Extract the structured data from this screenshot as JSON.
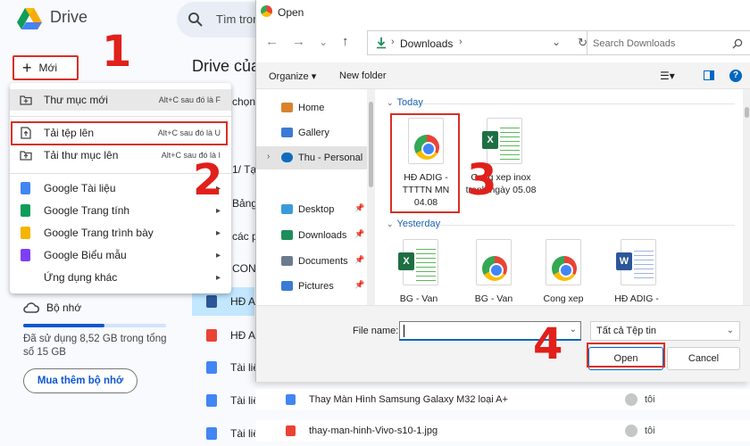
{
  "drive": {
    "title": "Drive",
    "search_text": "Tìm tron",
    "new_button": "Mới",
    "heading": "Drive của",
    "partial_texts": [
      "chọn",
      "1/ Tại",
      "Bảng",
      "các p",
      "CONT"
    ],
    "bg_rows": [
      "HĐ A",
      "HĐ A",
      "Tài liệ",
      "Tài liệ",
      "Tài liệ"
    ],
    "storage": {
      "label": "Bộ nhớ",
      "used_text": "Đã sử dụng 8,52 GB trong tổng số 15 GB",
      "used_fraction": 0.568,
      "buy_button": "Mua thêm bộ nhớ"
    }
  },
  "new_menu": {
    "items": [
      {
        "label": "Thư mục mới",
        "shortcut": "Alt+C sau đó là F",
        "icon": "new-folder-icon",
        "color": "#444746"
      },
      {
        "label": "Tải tệp lên",
        "shortcut": "Alt+C sau đó là U",
        "icon": "upload-file-icon",
        "color": "#444746"
      },
      {
        "label": "Tải thư mục lên",
        "shortcut": "Alt+C sau đó là I",
        "icon": "upload-folder-icon",
        "color": "#444746"
      },
      {
        "label": "Google Tài liệu",
        "shortcut": "",
        "icon": "google-docs-icon",
        "color": "#4285f4"
      },
      {
        "label": "Google Trang tính",
        "shortcut": "",
        "icon": "google-sheets-icon",
        "color": "#0f9d58"
      },
      {
        "label": "Google Trang trình bày",
        "shortcut": "",
        "icon": "google-slides-icon",
        "color": "#f4b400"
      },
      {
        "label": "Google Biểu mẫu",
        "shortcut": "",
        "icon": "google-forms-icon",
        "color": "#7e3ff2"
      },
      {
        "label": "Ứng dụng khác",
        "shortcut": "",
        "icon": "more-apps-icon",
        "color": "#ffffff"
      }
    ]
  },
  "annotations": {
    "step1": "1",
    "step2": "2",
    "step3": "3",
    "step4": "4",
    "color": "#e0201b"
  },
  "dialog": {
    "title": "Open",
    "address": "Downloads",
    "search_placeholder": "Search Downloads",
    "toolbar": {
      "organize": "Organize ▾",
      "new_folder": "New folder"
    },
    "nav_items": [
      {
        "label": "Home",
        "icon": "home-icon",
        "color": "#d9822b"
      },
      {
        "label": "Gallery",
        "icon": "gallery-icon",
        "color": "#3a7bd5"
      },
      {
        "label": "Thu - Personal",
        "icon": "onedrive-icon",
        "color": "#0f6cbd"
      },
      {
        "label": "Desktop",
        "icon": "desktop-icon",
        "color": "#3a9bdc"
      },
      {
        "label": "Downloads",
        "icon": "downloads-icon",
        "color": "#1e8e5a"
      },
      {
        "label": "Documents",
        "icon": "documents-icon",
        "color": "#6b7b8c"
      },
      {
        "label": "Pictures",
        "icon": "pictures-icon",
        "color": "#3a7bd5"
      }
    ],
    "groups": {
      "today": "Today",
      "yesterday": "Yesterday"
    },
    "today_files": [
      {
        "name": "HĐ ADIG - TTTTN MN 04.08",
        "type": "chrome"
      },
      {
        "name": "Cong xep inox tranh ngày 05.08",
        "type": "excel"
      }
    ],
    "yesterday_files": [
      {
        "name": "BG - Van",
        "type": "excel"
      },
      {
        "name": "BG - Van",
        "type": "chrome"
      },
      {
        "name": "Cong xep",
        "type": "chrome"
      },
      {
        "name": "HĐ ADIG -",
        "type": "word"
      }
    ],
    "file_name_label": "File name:",
    "file_name_value": "",
    "file_type": "Tất cả Tệp tin",
    "open_button": "Open",
    "cancel_button": "Cancel"
  },
  "bottom_rows": [
    {
      "name": "Thay Màn Hình Samsung Galaxy M32 loại A+",
      "owner": "tôi",
      "color": "#4285f4"
    },
    {
      "name": "thay-man-hinh-Vivo-s10-1.jpg",
      "owner": "tôi",
      "color": "#ea4335"
    }
  ]
}
